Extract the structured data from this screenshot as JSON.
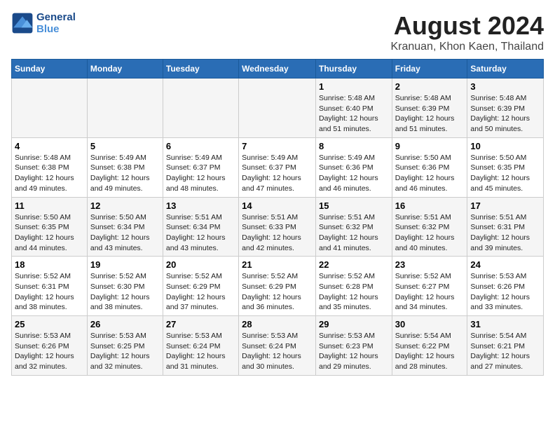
{
  "header": {
    "logo_line1": "General",
    "logo_line2": "Blue",
    "title": "August 2024",
    "subtitle": "Kranuan, Khon Kaen, Thailand"
  },
  "weekdays": [
    "Sunday",
    "Monday",
    "Tuesday",
    "Wednesday",
    "Thursday",
    "Friday",
    "Saturday"
  ],
  "weeks": [
    [
      {
        "day": "",
        "info": ""
      },
      {
        "day": "",
        "info": ""
      },
      {
        "day": "",
        "info": ""
      },
      {
        "day": "",
        "info": ""
      },
      {
        "day": "1",
        "info": "Sunrise: 5:48 AM\nSunset: 6:40 PM\nDaylight: 12 hours\nand 51 minutes."
      },
      {
        "day": "2",
        "info": "Sunrise: 5:48 AM\nSunset: 6:39 PM\nDaylight: 12 hours\nand 51 minutes."
      },
      {
        "day": "3",
        "info": "Sunrise: 5:48 AM\nSunset: 6:39 PM\nDaylight: 12 hours\nand 50 minutes."
      }
    ],
    [
      {
        "day": "4",
        "info": "Sunrise: 5:48 AM\nSunset: 6:38 PM\nDaylight: 12 hours\nand 49 minutes."
      },
      {
        "day": "5",
        "info": "Sunrise: 5:49 AM\nSunset: 6:38 PM\nDaylight: 12 hours\nand 49 minutes."
      },
      {
        "day": "6",
        "info": "Sunrise: 5:49 AM\nSunset: 6:37 PM\nDaylight: 12 hours\nand 48 minutes."
      },
      {
        "day": "7",
        "info": "Sunrise: 5:49 AM\nSunset: 6:37 PM\nDaylight: 12 hours\nand 47 minutes."
      },
      {
        "day": "8",
        "info": "Sunrise: 5:49 AM\nSunset: 6:36 PM\nDaylight: 12 hours\nand 46 minutes."
      },
      {
        "day": "9",
        "info": "Sunrise: 5:50 AM\nSunset: 6:36 PM\nDaylight: 12 hours\nand 46 minutes."
      },
      {
        "day": "10",
        "info": "Sunrise: 5:50 AM\nSunset: 6:35 PM\nDaylight: 12 hours\nand 45 minutes."
      }
    ],
    [
      {
        "day": "11",
        "info": "Sunrise: 5:50 AM\nSunset: 6:35 PM\nDaylight: 12 hours\nand 44 minutes."
      },
      {
        "day": "12",
        "info": "Sunrise: 5:50 AM\nSunset: 6:34 PM\nDaylight: 12 hours\nand 43 minutes."
      },
      {
        "day": "13",
        "info": "Sunrise: 5:51 AM\nSunset: 6:34 PM\nDaylight: 12 hours\nand 43 minutes."
      },
      {
        "day": "14",
        "info": "Sunrise: 5:51 AM\nSunset: 6:33 PM\nDaylight: 12 hours\nand 42 minutes."
      },
      {
        "day": "15",
        "info": "Sunrise: 5:51 AM\nSunset: 6:32 PM\nDaylight: 12 hours\nand 41 minutes."
      },
      {
        "day": "16",
        "info": "Sunrise: 5:51 AM\nSunset: 6:32 PM\nDaylight: 12 hours\nand 40 minutes."
      },
      {
        "day": "17",
        "info": "Sunrise: 5:51 AM\nSunset: 6:31 PM\nDaylight: 12 hours\nand 39 minutes."
      }
    ],
    [
      {
        "day": "18",
        "info": "Sunrise: 5:52 AM\nSunset: 6:31 PM\nDaylight: 12 hours\nand 38 minutes."
      },
      {
        "day": "19",
        "info": "Sunrise: 5:52 AM\nSunset: 6:30 PM\nDaylight: 12 hours\nand 38 minutes."
      },
      {
        "day": "20",
        "info": "Sunrise: 5:52 AM\nSunset: 6:29 PM\nDaylight: 12 hours\nand 37 minutes."
      },
      {
        "day": "21",
        "info": "Sunrise: 5:52 AM\nSunset: 6:29 PM\nDaylight: 12 hours\nand 36 minutes."
      },
      {
        "day": "22",
        "info": "Sunrise: 5:52 AM\nSunset: 6:28 PM\nDaylight: 12 hours\nand 35 minutes."
      },
      {
        "day": "23",
        "info": "Sunrise: 5:52 AM\nSunset: 6:27 PM\nDaylight: 12 hours\nand 34 minutes."
      },
      {
        "day": "24",
        "info": "Sunrise: 5:53 AM\nSunset: 6:26 PM\nDaylight: 12 hours\nand 33 minutes."
      }
    ],
    [
      {
        "day": "25",
        "info": "Sunrise: 5:53 AM\nSunset: 6:26 PM\nDaylight: 12 hours\nand 32 minutes."
      },
      {
        "day": "26",
        "info": "Sunrise: 5:53 AM\nSunset: 6:25 PM\nDaylight: 12 hours\nand 32 minutes."
      },
      {
        "day": "27",
        "info": "Sunrise: 5:53 AM\nSunset: 6:24 PM\nDaylight: 12 hours\nand 31 minutes."
      },
      {
        "day": "28",
        "info": "Sunrise: 5:53 AM\nSunset: 6:24 PM\nDaylight: 12 hours\nand 30 minutes."
      },
      {
        "day": "29",
        "info": "Sunrise: 5:53 AM\nSunset: 6:23 PM\nDaylight: 12 hours\nand 29 minutes."
      },
      {
        "day": "30",
        "info": "Sunrise: 5:54 AM\nSunset: 6:22 PM\nDaylight: 12 hours\nand 28 minutes."
      },
      {
        "day": "31",
        "info": "Sunrise: 5:54 AM\nSunset: 6:21 PM\nDaylight: 12 hours\nand 27 minutes."
      }
    ]
  ]
}
